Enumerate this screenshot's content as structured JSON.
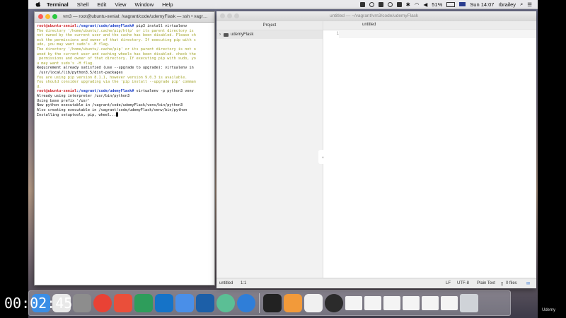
{
  "menubar": {
    "app": "Terminal",
    "items": [
      "Shell",
      "Edit",
      "View",
      "Window",
      "Help"
    ],
    "battery": "51%",
    "clock": "Sun 14:07",
    "user": "rbrailey"
  },
  "terminal": {
    "title": "vm3 — root@ubuntu-xenial: /vagrant/code/udemyFlask — ssh • vagr…",
    "lines": [
      {
        "type": "prompt",
        "user": "root@ubuntu-xenial",
        "path": ":/vagrant/code/udemyFlask#",
        "cmd": " pip3 install virtualenv"
      },
      {
        "type": "warn",
        "text": "The directory '/home/ubuntu/.cache/pip/http' or its parent directory is"
      },
      {
        "type": "warn",
        "text": "not owned by the current user and the cache has been disabled. Please ch"
      },
      {
        "type": "warn",
        "text": "eck the permissions and owner of that directory. If executing pip with s"
      },
      {
        "type": "warn",
        "text": "udo, you may want sudo's -H flag."
      },
      {
        "type": "warn",
        "text": "The directory '/home/ubuntu/.cache/pip' or its parent directory is not o"
      },
      {
        "type": "warn",
        "text": "wned by the current user and caching wheels has been disabled. check the"
      },
      {
        "type": "warn",
        "text": " permissions and owner of that directory. If executing pip with sudo, yo"
      },
      {
        "type": "warn",
        "text": "u may want sudo's -H flag."
      },
      {
        "type": "plain",
        "text": "Requirement already satisfied (use --upgrade to upgrade): virtualenv in"
      },
      {
        "type": "plain",
        "text": " /usr/local/lib/python3.5/dist-packages"
      },
      {
        "type": "warn",
        "text": "You are using pip version 8.1.1, however version 9.0.3 is available."
      },
      {
        "type": "warn",
        "text": "You should consider upgrading via the 'pip install --upgrade pip' comman"
      },
      {
        "type": "warn",
        "text": "d."
      },
      {
        "type": "prompt",
        "user": "root@ubuntu-xenial",
        "path": ":/vagrant/code/udemyFlask#",
        "cmd": " virtualenv -p python3 venv"
      },
      {
        "type": "plain",
        "text": "Already using interpreter /usr/bin/python3"
      },
      {
        "type": "plain",
        "text": "Using base prefix '/usr'"
      },
      {
        "type": "plain",
        "text": "New python executable in /vagrant/code/udemyFlask/venv/bin/python3"
      },
      {
        "type": "plain",
        "text": "Also creating executable in /vagrant/code/udemyFlask/venv/bin/python"
      },
      {
        "type": "cursor",
        "text": "Installing setuptools, pip, wheel..."
      }
    ]
  },
  "editor": {
    "title": "untitled — ~/vagrant/vm3/code/udemyFlask",
    "tree_header": "Project",
    "folder": "udemyFlask",
    "tab": "untitled",
    "line_number": "1",
    "status": {
      "file": "untitled",
      "cursor": "1:1",
      "line_ending": "LF",
      "encoding": "UTF-8",
      "grammar": "Plain Text",
      "files": "0 files"
    }
  },
  "overlay": {
    "timecode": "00:02:45",
    "watermark": "Udemy"
  },
  "dock": {
    "icons": [
      "finder-icon",
      "scrivener-icon",
      "system-preferences-icon",
      "chrome-icon",
      "8x8-icon",
      "remote-desktop-icon",
      "outlook-icon",
      "mail-icon",
      "virtualbox-icon",
      "atom-icon",
      "safari-icon",
      "terminal-icon",
      "sublime-icon",
      "preview-icon",
      "obs-icon"
    ],
    "colors": [
      "#3a8ee6",
      "#e8e8e8",
      "#8d8d8d",
      "#e94235",
      "#ea4f3a",
      "#2e9d5b",
      "#1573c8",
      "#4a8fe8",
      "#1c5fa8",
      "#5bbf95",
      "#2f7ed8",
      "#222222",
      "#f29a3a",
      "#f0f0f0",
      "#2b2b2b"
    ]
  }
}
